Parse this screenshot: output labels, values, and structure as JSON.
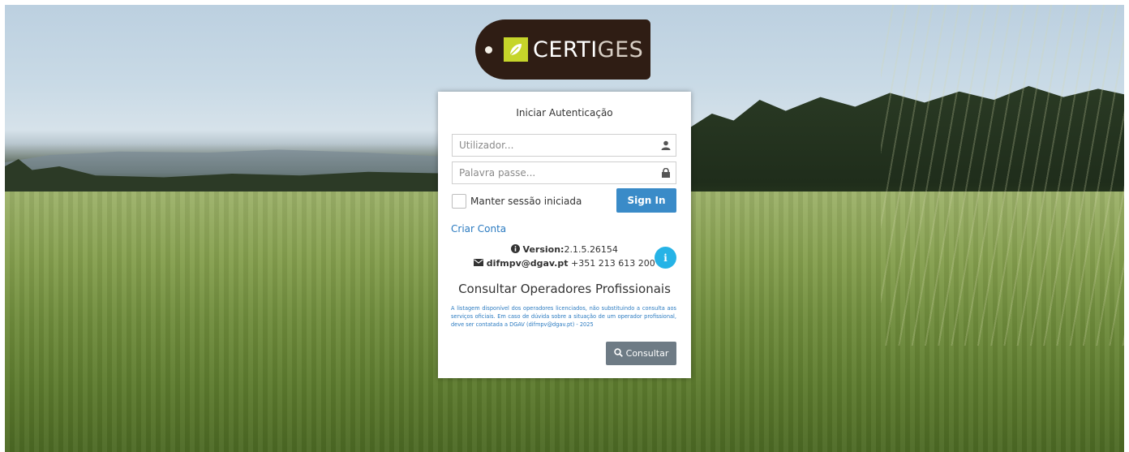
{
  "brand": {
    "name_part1": "CERTI",
    "name_part2": "GES",
    "leaf_color": "#c6d52a",
    "tag_color": "#2f1d14"
  },
  "login": {
    "title": "Iniciar Autenticação",
    "username_placeholder": "Utilizador...",
    "password_placeholder": "Palavra passe...",
    "remember_label": "Manter sessão iniciada",
    "signin_label": "Sign In",
    "create_account_label": "Criar Conta"
  },
  "info": {
    "version_label": "Version:",
    "version_value": "2.1.5.26154",
    "email": "difmpv@dgav.pt",
    "phone": "+351 213 613 200"
  },
  "operators": {
    "heading": "Consultar Operadores Profissionais",
    "notice": "A listagem disponível dos operadores licenciados, não substituindo a consulta aos serviços oficiais. Em caso de dúvida sobre a situação de um operador profissional, deve ser contatada a DGAV (difmpv@dgav.pt) - 2025",
    "consult_label": "Consultar"
  },
  "icons": {
    "username": "user-icon",
    "password": "lock-icon",
    "version": "info-circle-icon",
    "email": "envelope-icon",
    "info_button": "info-icon",
    "consult": "search-icon"
  },
  "colors": {
    "primary": "#3a8bc8",
    "info": "#26b3e6",
    "secondary": "#6e7b85",
    "link": "#2a7ac0"
  }
}
